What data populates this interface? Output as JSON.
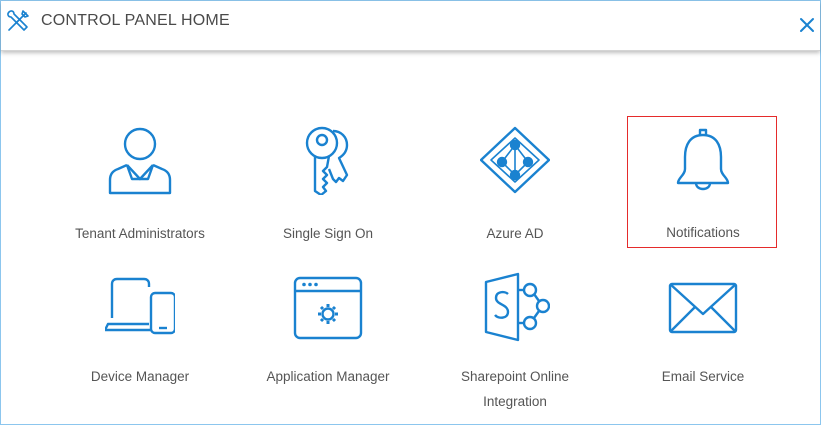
{
  "header": {
    "title": "CONTROL PANEL HOME",
    "close_label": "Close"
  },
  "tiles": [
    {
      "label": "Tenant Administrators",
      "icon": "user-admin-icon"
    },
    {
      "label": "Single Sign On",
      "icon": "keys-icon"
    },
    {
      "label": "Azure AD",
      "icon": "azure-ad-icon"
    },
    {
      "label": "Notifications",
      "icon": "bell-icon",
      "selected": true
    },
    {
      "label": "Device Manager",
      "icon": "devices-icon"
    },
    {
      "label": "Application Manager",
      "icon": "app-window-gear-icon"
    },
    {
      "label": "Sharepoint Online Integration",
      "icon": "sharepoint-icon"
    },
    {
      "label": "Email Service",
      "icon": "envelope-icon"
    }
  ],
  "colors": {
    "icon": "#1a82d0",
    "selection": "#e52b2b",
    "label": "#555555",
    "border": "#8cc6ee"
  }
}
